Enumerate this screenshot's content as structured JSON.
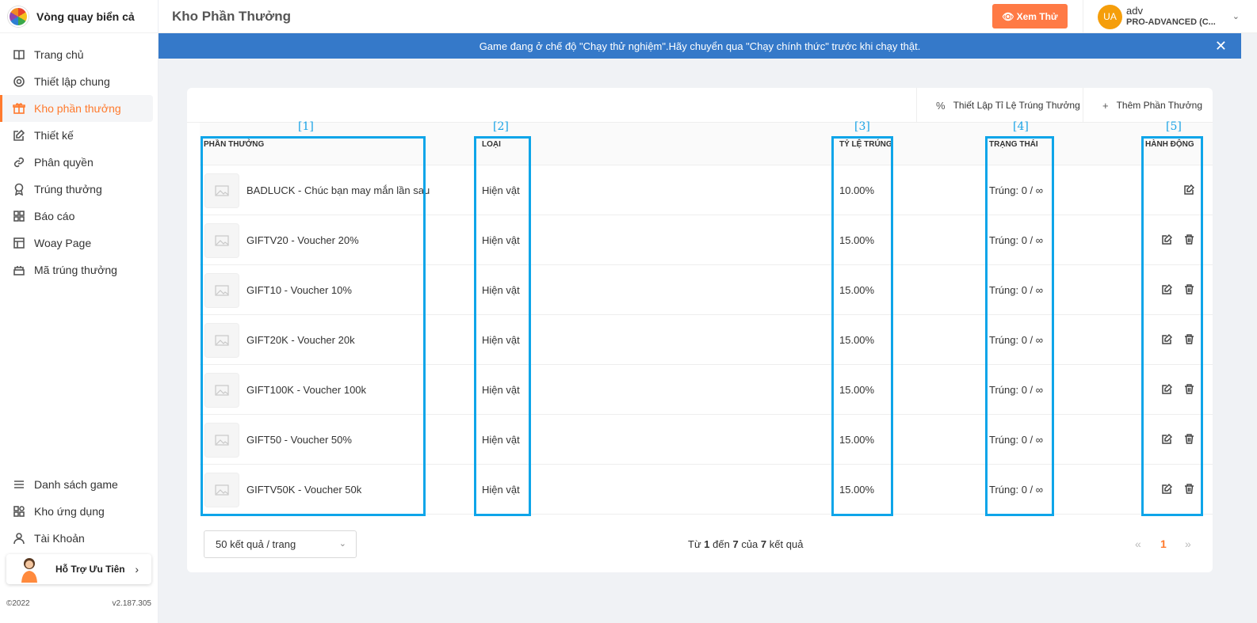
{
  "app": {
    "name": "Vòng quay biển cả",
    "copyright": "©2022",
    "version": "v2.187.305"
  },
  "sidebar": {
    "items": [
      {
        "label": "Trang chủ",
        "icon": "book-icon"
      },
      {
        "label": "Thiết lập chung",
        "icon": "gear-icon"
      },
      {
        "label": "Kho phần thưởng",
        "icon": "gift-icon",
        "active": true
      },
      {
        "label": "Thiết kế",
        "icon": "edit-icon"
      },
      {
        "label": "Phân quyền",
        "icon": "link-icon"
      },
      {
        "label": "Trúng thưởng",
        "icon": "award-icon"
      },
      {
        "label": "Báo cáo",
        "icon": "grid-icon"
      },
      {
        "label": "Woay Page",
        "icon": "layout-icon"
      },
      {
        "label": "Mã trúng thưởng",
        "icon": "cake-icon"
      }
    ],
    "bottom_items": [
      {
        "label": "Danh sách game",
        "icon": "menu-icon"
      },
      {
        "label": "Kho ứng dụng",
        "icon": "apps-icon"
      },
      {
        "label": "Tài Khoản",
        "icon": "user-icon"
      }
    ],
    "support_label": "Hỗ Trợ Ưu Tiên"
  },
  "header": {
    "title": "Kho Phần Thưởng",
    "preview_label": "Xem Thử",
    "user_initials": "UA",
    "user_name": "adv",
    "user_plan": "PRO-ADVANCED (C..."
  },
  "banner": {
    "text": "Game đang ở chế độ \"Chạy thử nghiệm\".Hãy chuyển qua \"Chạy chính thức\" trước khi chạy thật."
  },
  "toolbar": {
    "rate_label": "Thiết Lập Tỉ Lệ Trúng Thưởng",
    "add_label": "Thêm Phần Thưởng"
  },
  "table": {
    "columns": [
      "PHẦN THƯỞNG",
      "LOẠI",
      "TỶ LỆ TRÚNG",
      "TRẠNG THÁI",
      "HÀNH ĐỘNG"
    ],
    "rows": [
      {
        "name": "BADLUCK - Chúc bạn may mắn lần sau",
        "type": "Hiện vật",
        "rate": "10.00%",
        "status": "Trúng: 0 / ∞",
        "deletable": false
      },
      {
        "name": "GIFTV20 - Voucher 20%",
        "type": "Hiện vật",
        "rate": "15.00%",
        "status": "Trúng: 0 / ∞",
        "deletable": true
      },
      {
        "name": "GIFT10 - Voucher 10%",
        "type": "Hiện vật",
        "rate": "15.00%",
        "status": "Trúng: 0 / ∞",
        "deletable": true
      },
      {
        "name": "GIFT20K - Voucher 20k",
        "type": "Hiện vật",
        "rate": "15.00%",
        "status": "Trúng: 0 / ∞",
        "deletable": true
      },
      {
        "name": "GIFT100K - Voucher 100k",
        "type": "Hiện vật",
        "rate": "15.00%",
        "status": "Trúng: 0 / ∞",
        "deletable": true
      },
      {
        "name": "GIFT50 - Voucher 50%",
        "type": "Hiện vật",
        "rate": "15.00%",
        "status": "Trúng: 0 / ∞",
        "deletable": true
      },
      {
        "name": "GIFTV50K - Voucher 50k",
        "type": "Hiện vật",
        "rate": "15.00%",
        "status": "Trúng: 0 / ∞",
        "deletable": true
      }
    ]
  },
  "pagination": {
    "page_size": "50 kết quả / trang",
    "info_prefix": "Từ",
    "from": "1",
    "info_mid1": "đến",
    "to": "7",
    "info_mid2": "của",
    "total": "7",
    "info_suffix": "kết quả",
    "prev": "«",
    "current": "1",
    "next": "»"
  },
  "annotations": [
    "[1]",
    "[2]",
    "[3]",
    "[4]",
    "[5]"
  ],
  "colors": {
    "accent": "#ff7a2d",
    "banner": "#3579c9",
    "highlight": "#0ea5e9"
  }
}
